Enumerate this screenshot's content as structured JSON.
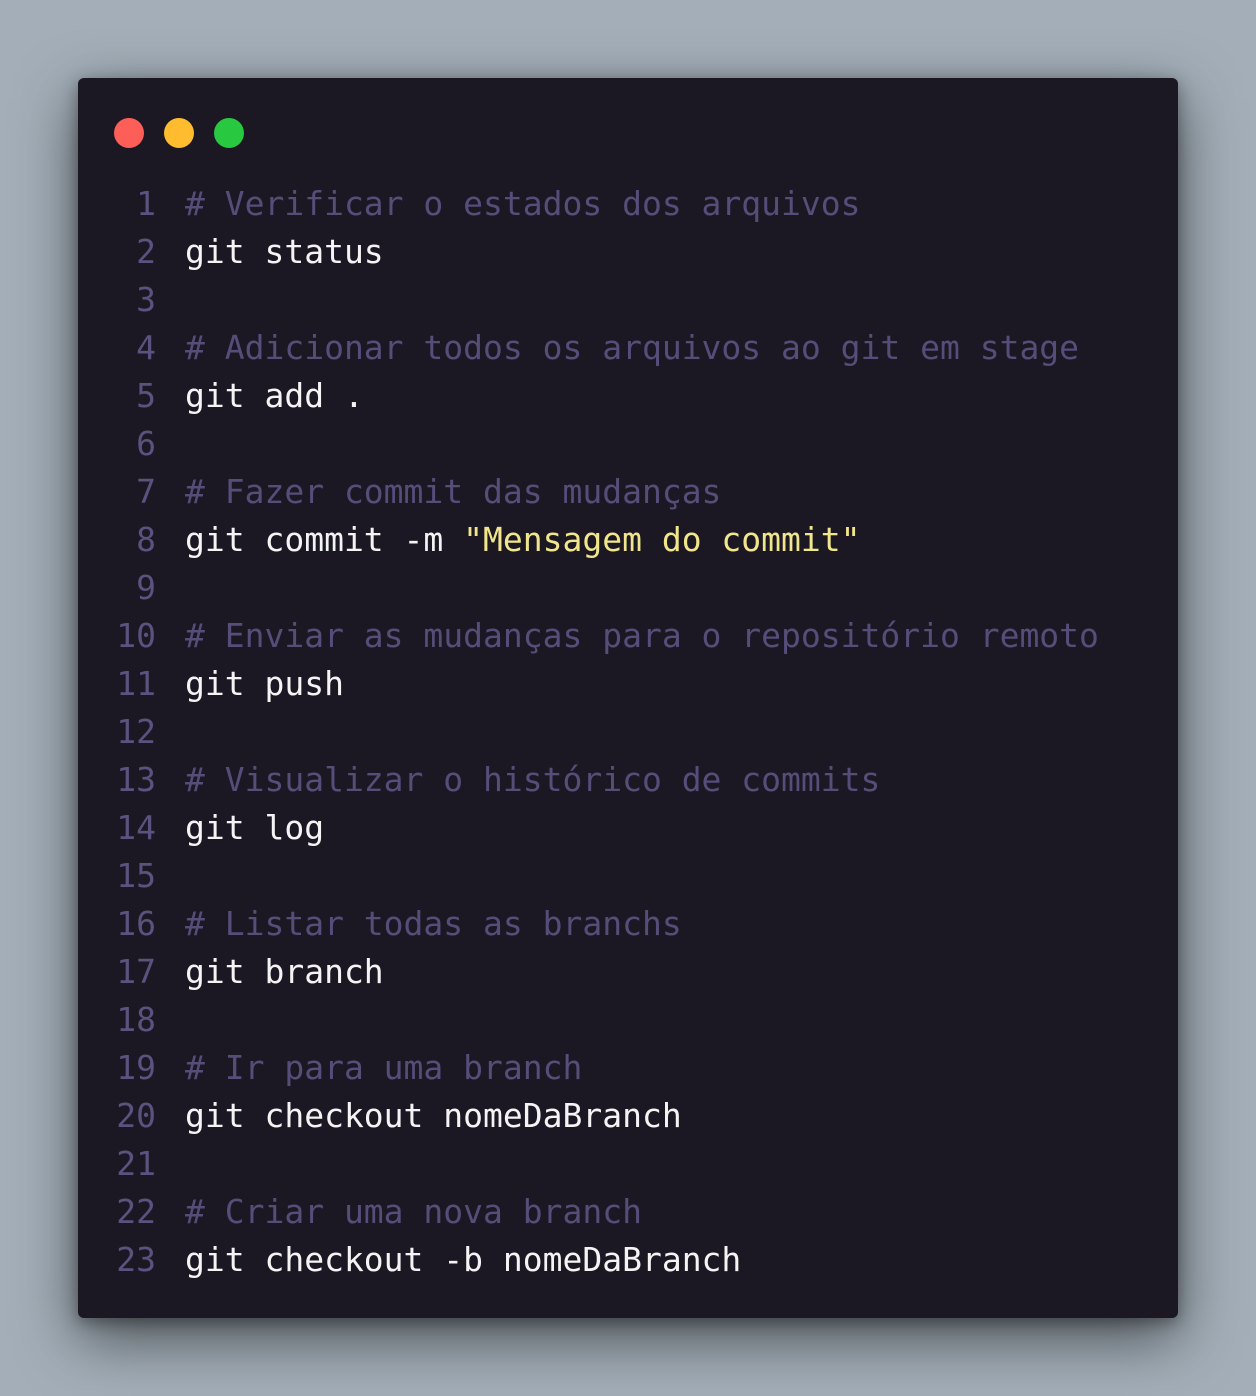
{
  "colors": {
    "background": "#a3aeb8",
    "window": "#1b1823",
    "close": "#fd5f58",
    "minimize": "#febc2e",
    "maximize": "#28c840",
    "comment": "#564d79",
    "line_number": "#5c527f",
    "command": "#f4f4f4",
    "string": "#f1e68c"
  },
  "lines": [
    {
      "n": "1",
      "comment": "# Verificar o estados dos arquivos",
      "cmd": "",
      "str": ""
    },
    {
      "n": "2",
      "comment": "",
      "cmd": "git status",
      "str": ""
    },
    {
      "n": "3",
      "comment": "",
      "cmd": "",
      "str": ""
    },
    {
      "n": "4",
      "comment": "# Adicionar todos os arquivos ao git em stage",
      "cmd": "",
      "str": ""
    },
    {
      "n": "5",
      "comment": "",
      "cmd": "git add .",
      "str": ""
    },
    {
      "n": "6",
      "comment": "",
      "cmd": "",
      "str": ""
    },
    {
      "n": "7",
      "comment": "# Fazer commit das mudanças",
      "cmd": "",
      "str": ""
    },
    {
      "n": "8",
      "comment": "",
      "cmd": "git commit -m ",
      "str": "\"Mensagem do commit\""
    },
    {
      "n": "9",
      "comment": "",
      "cmd": "",
      "str": ""
    },
    {
      "n": "10",
      "comment": "# Enviar as mudanças para o repositório remoto",
      "cmd": "",
      "str": ""
    },
    {
      "n": "11",
      "comment": "",
      "cmd": "git push",
      "str": ""
    },
    {
      "n": "12",
      "comment": "",
      "cmd": "",
      "str": ""
    },
    {
      "n": "13",
      "comment": "# Visualizar o histórico de commits",
      "cmd": "",
      "str": ""
    },
    {
      "n": "14",
      "comment": "",
      "cmd": "git log",
      "str": ""
    },
    {
      "n": "15",
      "comment": "",
      "cmd": "",
      "str": ""
    },
    {
      "n": "16",
      "comment": "# Listar todas as branchs",
      "cmd": "",
      "str": ""
    },
    {
      "n": "17",
      "comment": "",
      "cmd": "git branch",
      "str": ""
    },
    {
      "n": "18",
      "comment": "",
      "cmd": "",
      "str": ""
    },
    {
      "n": "19",
      "comment": "# Ir para uma branch",
      "cmd": "",
      "str": ""
    },
    {
      "n": "20",
      "comment": "",
      "cmd": "git checkout nomeDaBranch",
      "str": ""
    },
    {
      "n": "21",
      "comment": "",
      "cmd": "",
      "str": ""
    },
    {
      "n": "22",
      "comment": "# Criar uma nova branch",
      "cmd": "",
      "str": ""
    },
    {
      "n": "23",
      "comment": "",
      "cmd": "git checkout -b nomeDaBranch",
      "str": ""
    }
  ]
}
